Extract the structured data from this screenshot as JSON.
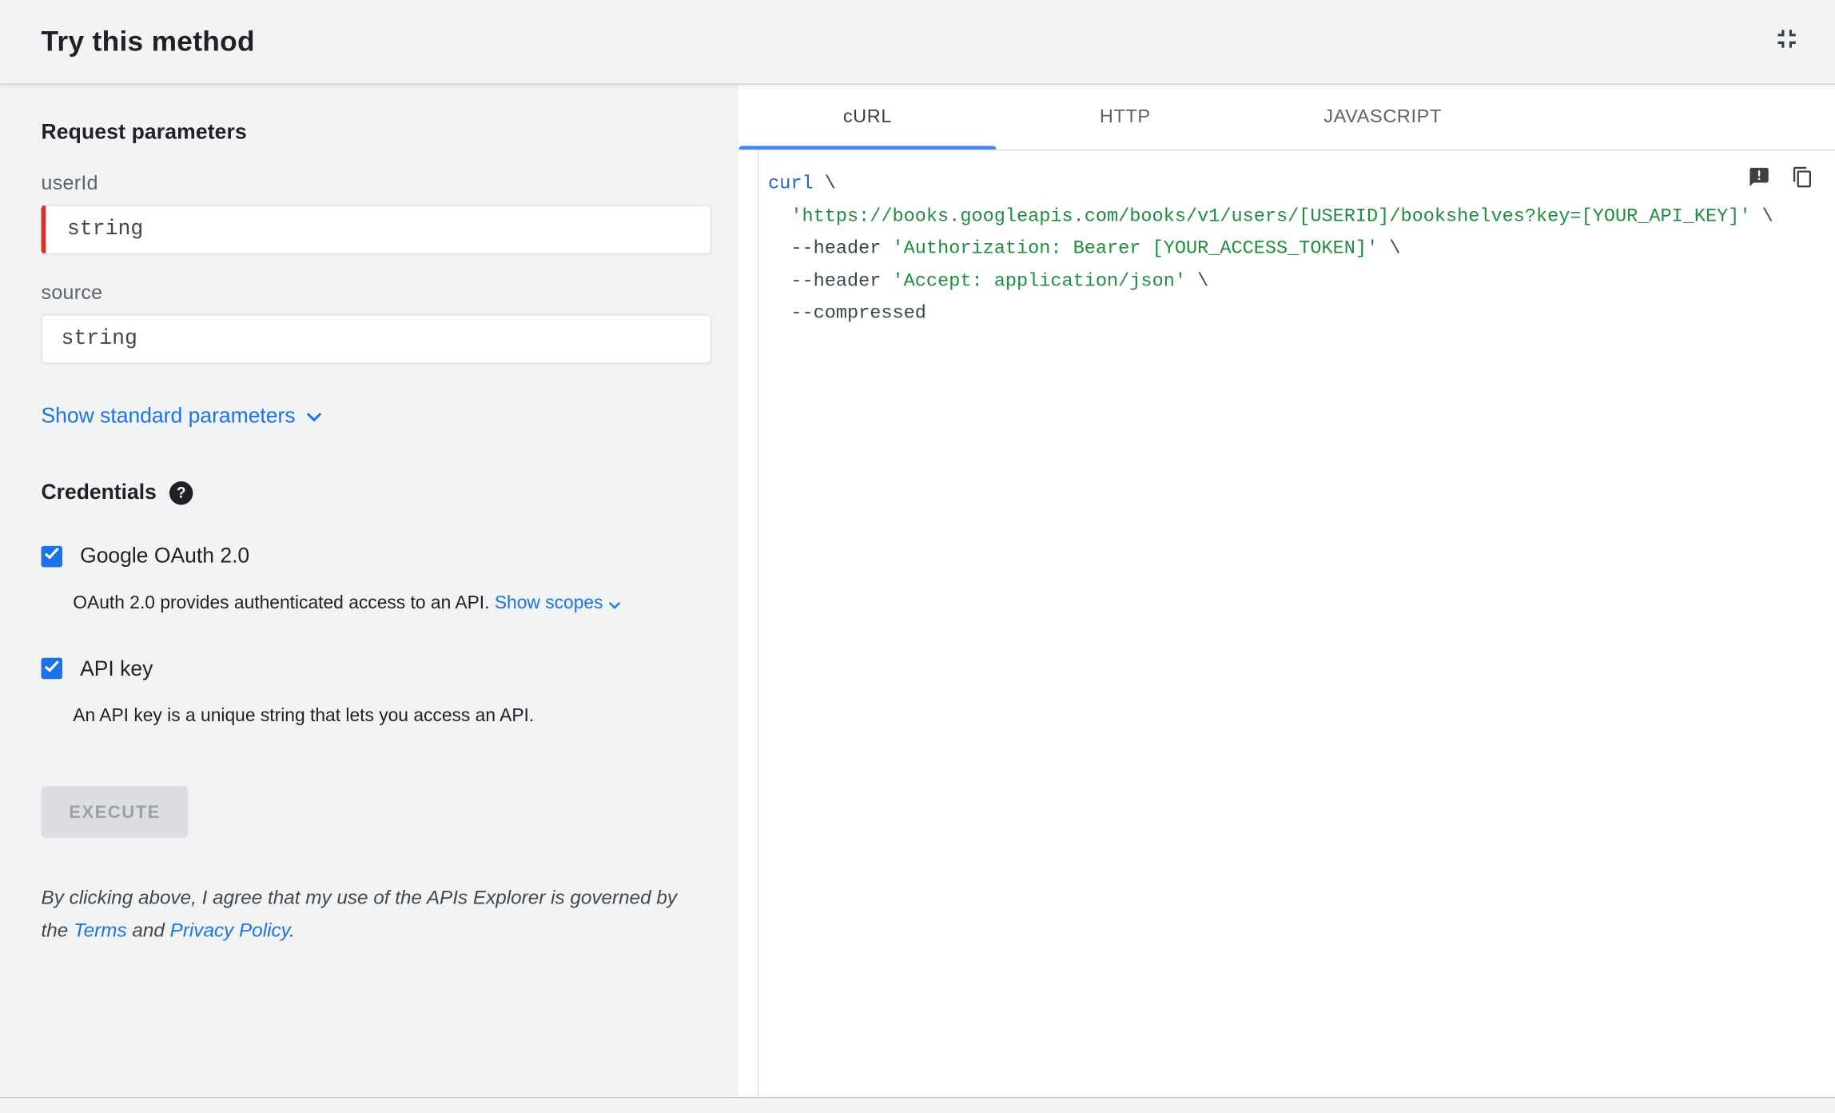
{
  "header": {
    "title": "Try this method"
  },
  "left": {
    "request_parameters_heading": "Request parameters",
    "fields": [
      {
        "label": "userId",
        "placeholder": "string",
        "required": true
      },
      {
        "label": "source",
        "placeholder": "string",
        "required": false
      }
    ],
    "show_standard_parameters_label": "Show standard parameters",
    "credentials_heading": "Credentials",
    "credentials_help_glyph": "?",
    "oauth": {
      "label": "Google OAuth 2.0",
      "checked": true,
      "description": "OAuth 2.0 provides authenticated access to an API. ",
      "show_scopes_label": "Show scopes"
    },
    "api_key": {
      "label": "API key",
      "checked": true,
      "description": "An API key is a unique string that lets you access an API."
    },
    "execute_label": "EXECUTE",
    "disclaimer": {
      "text_1": "By clicking above, I agree that my use of the APIs Explorer is governed by the ",
      "terms_link": "Terms",
      "text_2": " and ",
      "privacy_link": "Privacy Policy",
      "text_3": "."
    }
  },
  "tabs": [
    {
      "label": "cURL",
      "active": true
    },
    {
      "label": "HTTP",
      "active": false
    },
    {
      "label": "JAVASCRIPT",
      "active": false
    }
  ],
  "code": {
    "language": "curl",
    "lines": [
      {
        "tokens": [
          {
            "text": "curl",
            "type": "keyword"
          },
          {
            "text": " \\",
            "type": "plain"
          }
        ]
      },
      {
        "tokens": [
          {
            "text": "  ",
            "type": "plain"
          },
          {
            "text": "'https://books.googleapis.com/books/v1/users/[USERID]/bookshelves?key=[YOUR_API_KEY]'",
            "type": "string"
          },
          {
            "text": " \\",
            "type": "plain"
          }
        ]
      },
      {
        "tokens": [
          {
            "text": "  --header ",
            "type": "plain"
          },
          {
            "text": "'Authorization: Bearer [YOUR_ACCESS_TOKEN]'",
            "type": "string"
          },
          {
            "text": " \\",
            "type": "plain"
          }
        ]
      },
      {
        "tokens": [
          {
            "text": "  --header ",
            "type": "plain"
          },
          {
            "text": "'Accept: application/json'",
            "type": "string"
          },
          {
            "text": " \\",
            "type": "plain"
          }
        ]
      },
      {
        "tokens": [
          {
            "text": "  --compressed",
            "type": "plain"
          }
        ]
      }
    ]
  },
  "icons": {
    "collapse": "collapse-icon",
    "help": "help-icon",
    "chevron_down": "chevron-down-icon",
    "checkmark": "checkmark-icon",
    "feedback": "feedback-icon",
    "copy": "copy-icon"
  },
  "colors": {
    "accent_blue": "#1a73e8",
    "tab_underline": "#4285f4",
    "required_red": "#d93025",
    "keyword_blue": "#1967d2",
    "string_green": "#1e8e3e",
    "code_plain": "#37474f",
    "left_background": "#f1f3f4",
    "disabled_button_bg": "#dbdde0",
    "disabled_button_text": "#9aa0a6"
  }
}
